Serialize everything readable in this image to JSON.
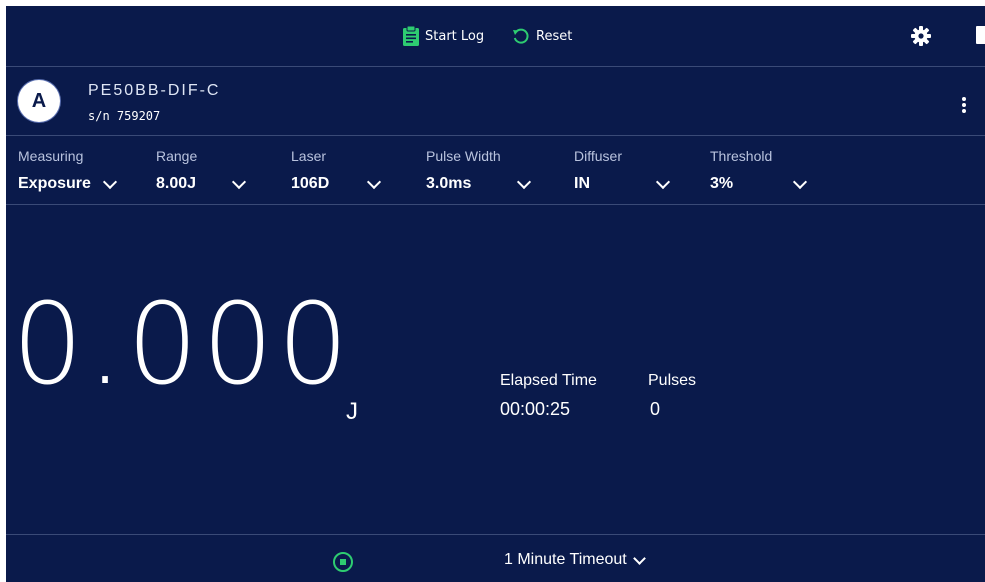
{
  "toolbar": {
    "start_log_label": "Start Log",
    "reset_label": "Reset",
    "icons": [
      "clipboard-icon",
      "reset-icon",
      "gear-icon",
      "power-icon"
    ],
    "accent_color": "#2ecc71"
  },
  "device": {
    "channel": "A",
    "name": "PE50BB-DIF-C",
    "serial": "s/n 759207"
  },
  "settings": [
    {
      "label": "Measuring",
      "value": "Exposure"
    },
    {
      "label": "Range",
      "value": "8.00J"
    },
    {
      "label": "Laser",
      "value": "106D"
    },
    {
      "label": "Pulse Width",
      "value": "3.0ms"
    },
    {
      "label": "Diffuser",
      "value": "IN"
    },
    {
      "label": "Threshold",
      "value": "3%"
    }
  ],
  "reading": {
    "value": "0.000",
    "unit": "J"
  },
  "stats": {
    "elapsed_label": "Elapsed Time",
    "elapsed_value": "00:00:25",
    "pulses_label": "Pulses",
    "pulses_value": "0"
  },
  "footer": {
    "timeout_label": "1 Minute Timeout"
  },
  "colors": {
    "background": "#0a1a4b",
    "divider": "#3a4a77",
    "text": "#ffffff"
  }
}
